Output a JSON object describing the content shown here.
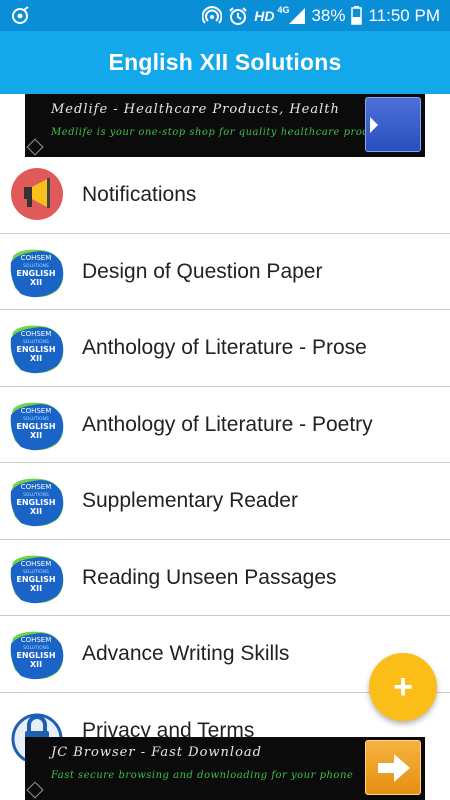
{
  "status_bar": {
    "hd": "HD",
    "network": "4G",
    "battery": "38%",
    "time": "11:50 PM"
  },
  "app_bar": {
    "title": "English XII Solutions"
  },
  "ads": {
    "top": {
      "title": "Medlife - Healthcare Products, Health",
      "text": "Medlife is your one-stop shop for quality healthcare products"
    },
    "bottom": {
      "title": "JC Browser - Fast Download",
      "text": "Fast secure browsing and downloading for your phone"
    }
  },
  "book_icon": {
    "line1": "COHSEM",
    "line2": "SOLUTIONS",
    "line3": "ENGLISH",
    "line4": "XII"
  },
  "menu": {
    "items": [
      {
        "label": "Notifications",
        "icon": "megaphone-icon"
      },
      {
        "label": "Design of Question Paper",
        "icon": "english-xii-book-icon"
      },
      {
        "label": "Anthology of Literature - Prose",
        "icon": "english-xii-book-icon"
      },
      {
        "label": "Anthology of Literature - Poetry",
        "icon": "english-xii-book-icon"
      },
      {
        "label": "Supplementary Reader",
        "icon": "english-xii-book-icon"
      },
      {
        "label": "Reading Unseen Passages",
        "icon": "english-xii-book-icon"
      },
      {
        "label": "Advance Writing Skills",
        "icon": "english-xii-book-icon"
      },
      {
        "label": "Privacy and Terms",
        "icon": "lock-icon"
      }
    ]
  },
  "fab": {
    "label": "+"
  },
  "colors": {
    "status_bar": "#0a8fd6",
    "app_bar": "#13a8ea",
    "fab": "#fbbd17",
    "notification_icon": "#e05a5a"
  }
}
